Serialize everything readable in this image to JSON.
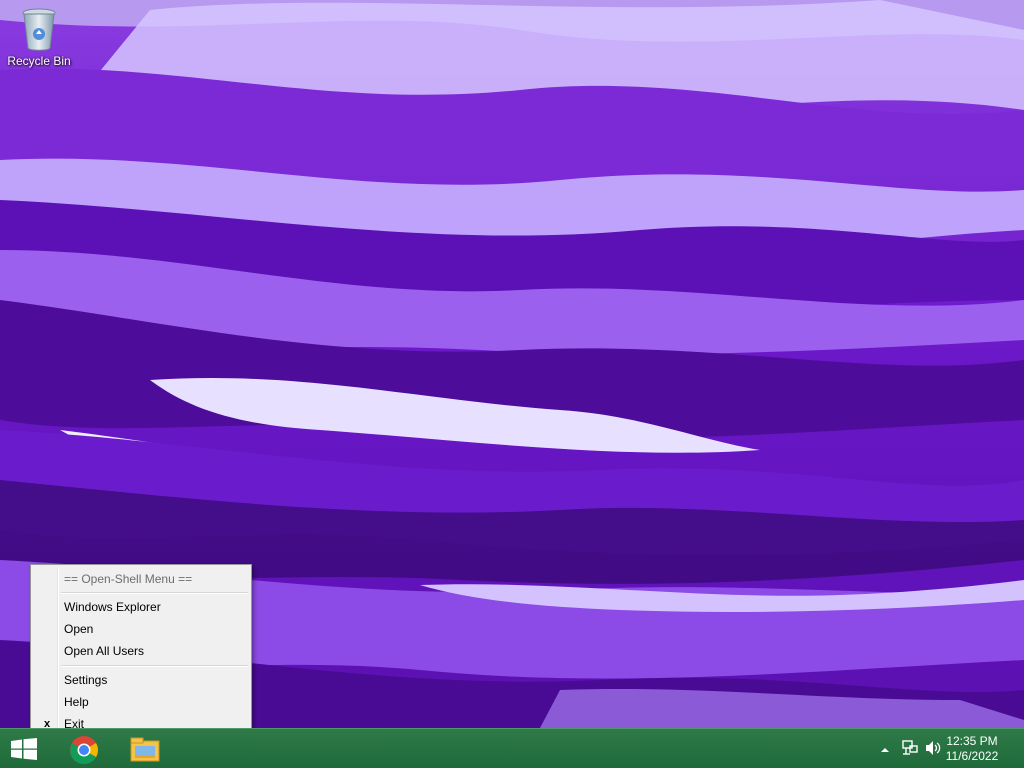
{
  "desktop": {
    "icons": [
      {
        "label": "Recycle Bin",
        "icon": "recycle-bin-icon"
      }
    ],
    "wallpaper_colors": {
      "base": "#6a17c8",
      "light": "#c9b4ff",
      "dark": "#3c0a6e"
    }
  },
  "context_menu": {
    "header": "== Open-Shell Menu ==",
    "items": [
      {
        "label": "Windows Explorer"
      },
      {
        "label": "Open"
      },
      {
        "label": "Open All Users"
      },
      {
        "label": "Settings"
      },
      {
        "label": "Help"
      },
      {
        "label": "Exit",
        "check": "x"
      }
    ]
  },
  "taskbar": {
    "color": "#246f3f",
    "start_icon": "windows-logo-icon",
    "pinned": [
      {
        "name": "Google Chrome",
        "icon": "chrome-icon"
      },
      {
        "name": "File Explorer",
        "icon": "file-explorer-icon"
      }
    ],
    "tray": {
      "icons": [
        "show-hidden-icons-chevron-icon",
        "network-icon",
        "volume-icon"
      ],
      "time": "12:35 PM",
      "date": "11/6/2022"
    }
  }
}
